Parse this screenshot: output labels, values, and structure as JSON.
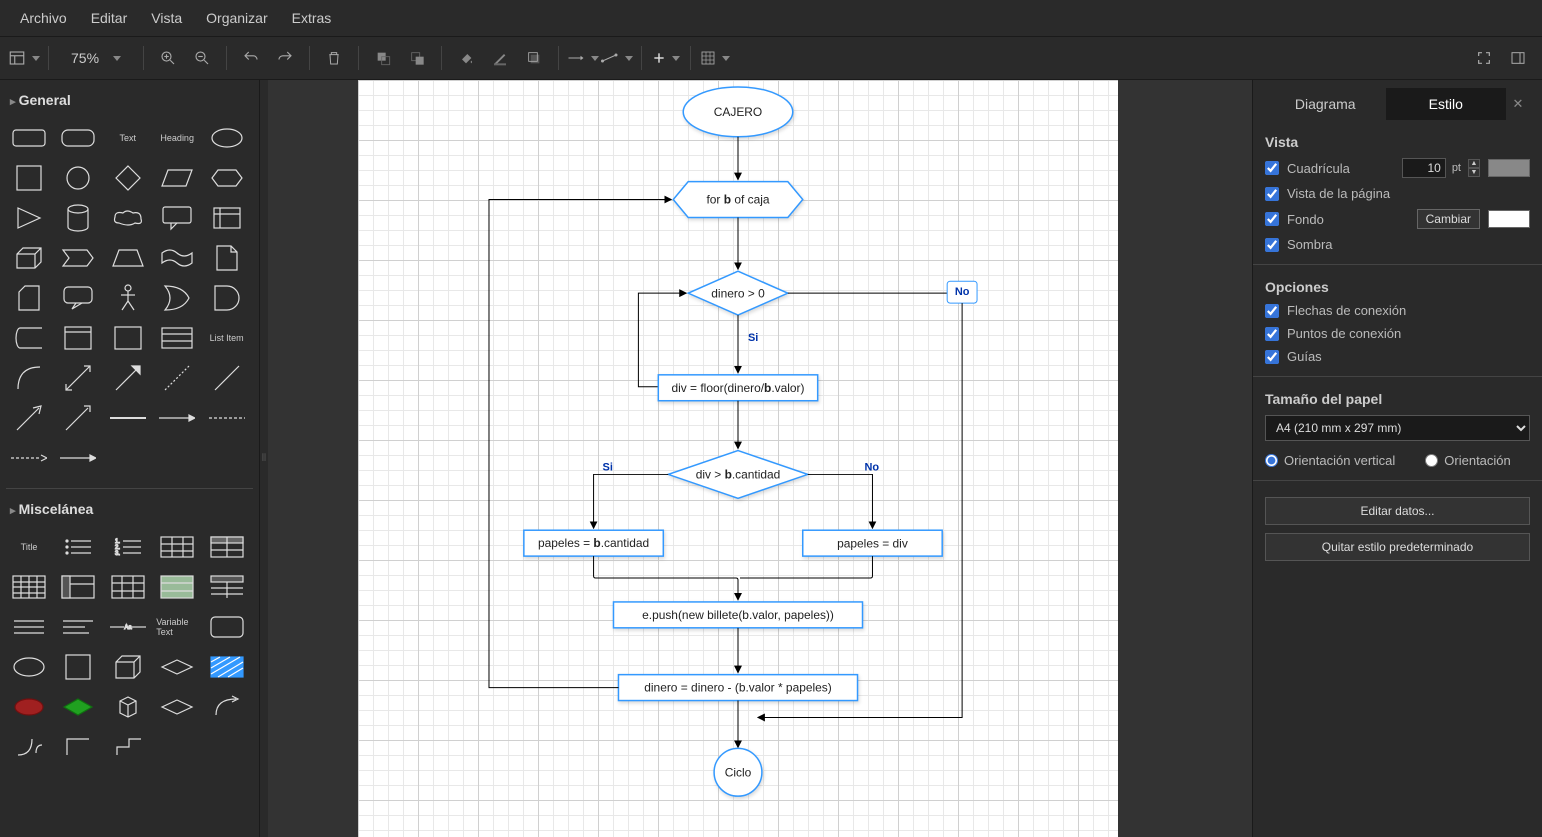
{
  "menu": {
    "file": "Archivo",
    "edit": "Editar",
    "view": "Vista",
    "arrange": "Organizar",
    "extras": "Extras"
  },
  "toolbar": {
    "zoom": "75%"
  },
  "shapesPanel": {
    "general": "General",
    "misc": "Miscelánea",
    "textLabel": "Text",
    "headingLabel": "Heading",
    "titleLabel": "Title",
    "listItemLabel": "List Item",
    "variableText": "Variable Text"
  },
  "rightPanel": {
    "tabs": {
      "diagram": "Diagrama",
      "style": "Estilo"
    },
    "view": {
      "title": "Vista",
      "grid": "Cuadrícula",
      "gridValue": "10",
      "gridUnit": "pt",
      "pageView": "Vista de la página",
      "background": "Fondo",
      "backgroundChange": "Cambiar",
      "shadow": "Sombra"
    },
    "options": {
      "title": "Opciones",
      "connArrows": "Flechas de conexión",
      "connPoints": "Puntos de conexión",
      "guides": "Guías"
    },
    "paper": {
      "title": "Tamaño del papel",
      "size": "A4 (210 mm x 297 mm)",
      "portrait": "Orientación vertical",
      "landscape": "Orientación"
    },
    "buttons": {
      "editData": "Editar datos...",
      "clearStyle": "Quitar estilo predeterminado"
    }
  },
  "flowchart": {
    "start": "CAJERO",
    "loop_pre": "for ",
    "loop_b": "b",
    "loop_post": " of caja",
    "cond1": "dinero > 0",
    "cond1_no": "No",
    "cond1_si": "Si",
    "proc1_pre": "div = floor(dinero/",
    "proc1_b": "b",
    "proc1_post": ".valor)",
    "cond2_pre": "div > ",
    "cond2_b": "b",
    "cond2_post": ".cantidad",
    "cond2_si": "Si",
    "cond2_no": "No",
    "proc2_pre": "papeles = ",
    "proc2_b": "b",
    "proc2_post": ".cantidad",
    "proc3": "papeles = div",
    "proc4": "e.push(new billete(b.valor,  papeles))",
    "proc5": "dinero = dinero - (b.valor * papeles)",
    "end": "Ciclo"
  }
}
